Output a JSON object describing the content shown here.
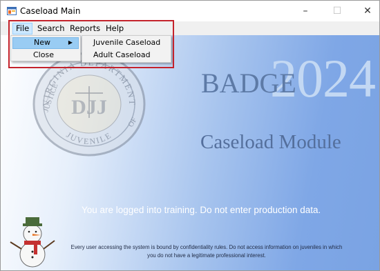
{
  "window": {
    "title": "Caseload Main",
    "minimize_glyph": "–",
    "maximize_glyph": "☐",
    "close_glyph": "✕"
  },
  "menubar": {
    "file": "File",
    "search": "Search",
    "reports": "Reports",
    "help": "Help"
  },
  "file_menu": {
    "new": "New",
    "close": "Close",
    "arrow_glyph": "▶"
  },
  "new_submenu": {
    "juvenile": "Juvenile Caseload",
    "adult": "Adult Caseload"
  },
  "branding": {
    "badge": "BADGE",
    "year": "2024",
    "module": "Caseload Module",
    "seal_top": "VIRGINIA DEPARTMENT",
    "seal_left": "JUSTICE",
    "seal_right": "OF",
    "seal_bottom": "JUVENILE",
    "seal_initials": "DJJ"
  },
  "notices": {
    "training": "You are logged into training. Do not enter production data.",
    "confidentiality": "Every user accessing the system is bound by confidentiality rules. Do not access information on juveniles in which you do not have a legitimate professional interest."
  },
  "colors": {
    "gradient_end": "#7aa3e3",
    "highlight": "#c4222b",
    "menu_selected": "#cce8ff"
  },
  "icons": {
    "app": "app-window-icon",
    "submenu_arrow": "chevron-right-icon",
    "snowman": "snowman-icon",
    "seal": "seal-icon"
  }
}
